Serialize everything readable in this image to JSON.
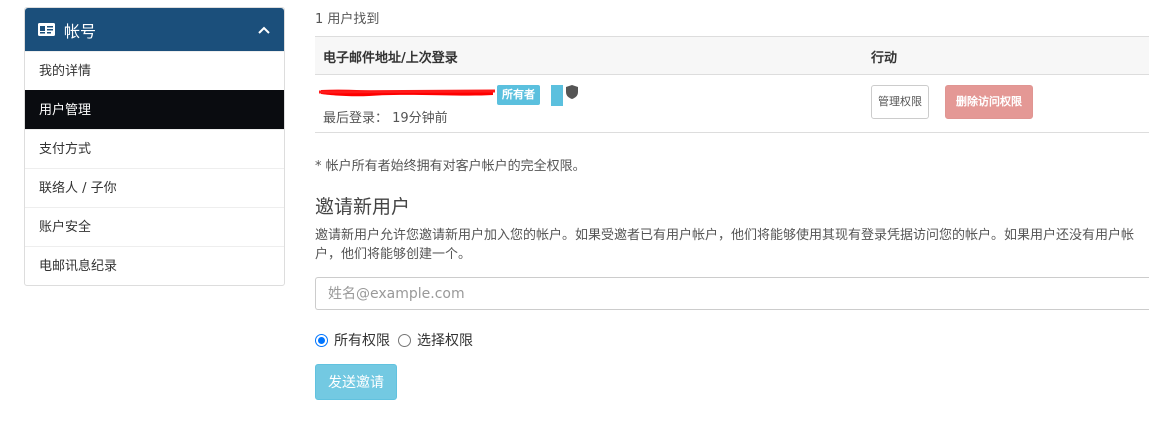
{
  "sidebar": {
    "title": "帐号",
    "icon": "id-card-icon",
    "items": [
      {
        "label": "我的详情",
        "active": false
      },
      {
        "label": "用户管理",
        "active": true
      },
      {
        "label": "支付方式",
        "active": false
      },
      {
        "label": "联络人 / 子你",
        "active": false
      },
      {
        "label": "账户安全",
        "active": false
      },
      {
        "label": "电邮讯息纪录",
        "active": false
      }
    ]
  },
  "users": {
    "found_text": "1 用户找到",
    "columns": [
      "电子邮件地址/上次登录",
      "行动"
    ],
    "rows": [
      {
        "owner_badge": "所有者",
        "last_login": "最后登录： 19分钟前",
        "manage_label": "管理权限",
        "revoke_label": "删除访问权限"
      }
    ]
  },
  "note": "* 帐户所有者始终拥有对客户帐户的完全权限。",
  "invite": {
    "title": "邀请新用户",
    "description": "邀请新用户允许您邀请新用户加入您的帐户。如果受邀者已有用户帐户，他们将能够使用其现有登录凭据访问您的帐户。如果用户还没有用户帐户，他们将能够创建一个。",
    "email_placeholder": "姓名@example.com",
    "radio_all": "所有权限",
    "radio_select": "选择权限",
    "send_label": "发送邀请"
  },
  "colors": {
    "sidebar_header": "#1b4f7b",
    "active_item": "#0a0c10",
    "info": "#5bc0de",
    "danger_light": "#e49895",
    "redaction": "#ff0000"
  }
}
